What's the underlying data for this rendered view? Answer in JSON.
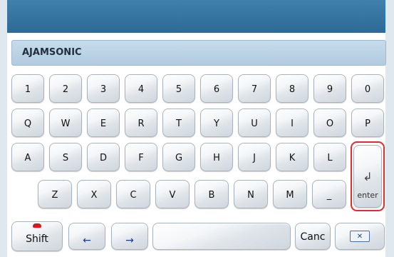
{
  "input": {
    "value": "AJAMSONIC"
  },
  "rows": {
    "numbers": [
      "1",
      "2",
      "3",
      "4",
      "5",
      "6",
      "7",
      "8",
      "9",
      "0"
    ],
    "row1": [
      "Q",
      "W",
      "E",
      "R",
      "T",
      "Y",
      "U",
      "I",
      "O",
      "P"
    ],
    "row2": [
      "A",
      "S",
      "D",
      "F",
      "G",
      "H",
      "J",
      "K",
      "L"
    ],
    "row3": [
      "Z",
      "X",
      "C",
      "V",
      "B",
      "N",
      "M",
      "_"
    ]
  },
  "special": {
    "enter_label": "enter",
    "enter_glyph": "↲",
    "shift_label": "Shift",
    "left_arrow": "←",
    "right_arrow": "→",
    "cancel_label": "Canc",
    "backspace_glyph": "✕"
  },
  "colors": {
    "title_bar": "#3478a6",
    "input_bg": "#bcd3e5",
    "highlight": "#e62b2b",
    "shift_dot": "#e0151c"
  }
}
